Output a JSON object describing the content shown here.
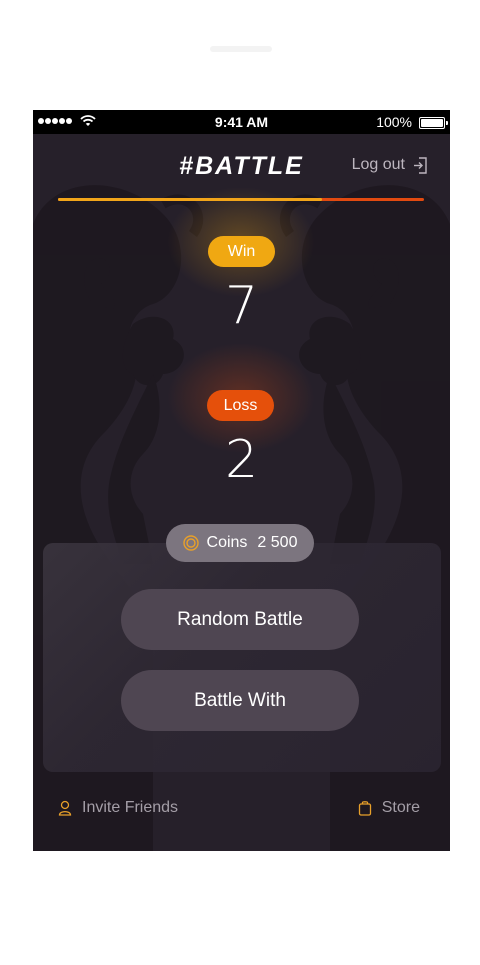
{
  "status_bar": {
    "time": "9:41 AM",
    "battery": "100%"
  },
  "header": {
    "title": "#BATTLE",
    "logout_label": "Log out"
  },
  "score_progress": {
    "win_fraction": 0.72
  },
  "stats": {
    "win_label": "Win",
    "win_value": "7",
    "loss_label": "Loss",
    "loss_value": "2"
  },
  "coins": {
    "label": "Coins",
    "value": "2 500"
  },
  "actions": {
    "random_battle": "Random Battle",
    "battle_with": "Battle With"
  },
  "footer": {
    "invite_friends": "Invite Friends",
    "store": "Store"
  },
  "colors": {
    "background": "#26202a",
    "win": "#f0a812",
    "loss": "#e5500b",
    "button": "#4f4652",
    "coins_pill": "#7c757f",
    "footer_icon": "#e8a02a"
  },
  "icons": {
    "logout": "logout-icon",
    "coin": "coin-icon",
    "invite": "user-icon",
    "store": "bag-icon"
  }
}
